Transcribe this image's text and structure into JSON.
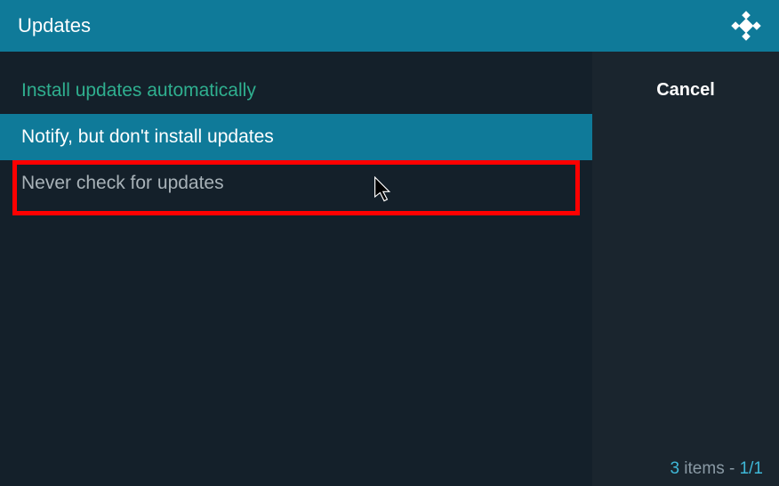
{
  "title": "Updates",
  "options": [
    {
      "label": "Install updates automatically",
      "state": "current"
    },
    {
      "label": "Notify, but don't install updates",
      "state": "selected"
    },
    {
      "label": "Never check for updates",
      "state": "normal"
    }
  ],
  "sidebar": {
    "cancel_label": "Cancel"
  },
  "footer": {
    "count": "3",
    "items_word": " items - ",
    "page": "1/1"
  }
}
